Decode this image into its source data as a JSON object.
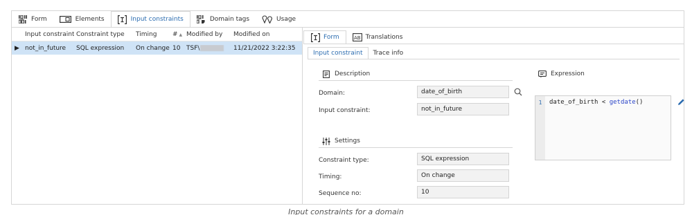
{
  "top_tabs": [
    {
      "label": "Form",
      "icon": "form-icon"
    },
    {
      "label": "Elements",
      "icon": "elements-icon"
    },
    {
      "label": "Input constraints",
      "icon": "input-constraints-icon",
      "active": true
    },
    {
      "label": "Domain tags",
      "icon": "domain-tags-icon"
    },
    {
      "label": "Usage",
      "icon": "usage-icon"
    }
  ],
  "grid": {
    "columns": [
      "Input constraint",
      "Constraint type",
      "Timing",
      "#",
      "Modified by",
      "Modified on"
    ],
    "rows": [
      {
        "input_constraint": "not_in_future",
        "constraint_type": "SQL expression",
        "timing": "On change",
        "seq": "10",
        "modified_by": "TSF\\",
        "modified_on": "11/21/2022 3:22:35"
      }
    ]
  },
  "right_tabs": [
    {
      "label": "Form",
      "active": true
    },
    {
      "label": "Translations"
    }
  ],
  "sub_tabs": [
    {
      "label": "Input constraint",
      "active": true
    },
    {
      "label": "Trace info"
    }
  ],
  "description_section": {
    "title": "Description",
    "domain_label": "Domain:",
    "domain_value": "date_of_birth",
    "input_constraint_label": "Input constraint:",
    "input_constraint_value": "not_in_future"
  },
  "settings_section": {
    "title": "Settings",
    "constraint_type_label": "Constraint type:",
    "constraint_type_value": "SQL expression",
    "timing_label": "Timing:",
    "timing_value": "On change",
    "sequence_label": "Sequence no:",
    "sequence_value": "10"
  },
  "expression_section": {
    "title": "Expression",
    "line_number": "1",
    "code_prefix": "date_of_birth < ",
    "code_fn": "getdate",
    "code_suffix": "()"
  },
  "caption": "Input constraints for a domain",
  "colors": {
    "accent": "#2b6cb0",
    "selected_row": "#cfe3f6",
    "field_bg": "#f2f2f2"
  }
}
